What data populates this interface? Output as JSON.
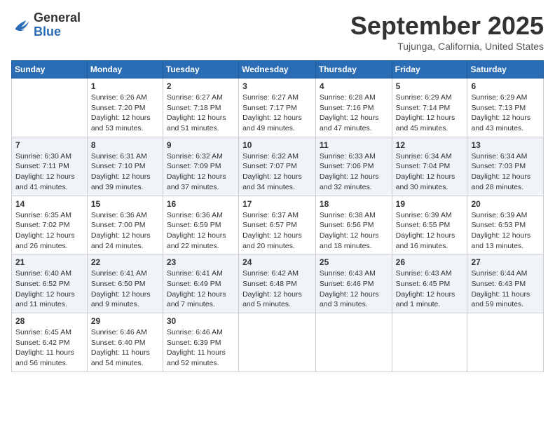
{
  "header": {
    "logo_general": "General",
    "logo_blue": "Blue",
    "month": "September 2025",
    "location": "Tujunga, California, United States"
  },
  "weekdays": [
    "Sunday",
    "Monday",
    "Tuesday",
    "Wednesday",
    "Thursday",
    "Friday",
    "Saturday"
  ],
  "weeks": [
    [
      {
        "day": "",
        "info": ""
      },
      {
        "day": "1",
        "info": "Sunrise: 6:26 AM\nSunset: 7:20 PM\nDaylight: 12 hours\nand 53 minutes."
      },
      {
        "day": "2",
        "info": "Sunrise: 6:27 AM\nSunset: 7:18 PM\nDaylight: 12 hours\nand 51 minutes."
      },
      {
        "day": "3",
        "info": "Sunrise: 6:27 AM\nSunset: 7:17 PM\nDaylight: 12 hours\nand 49 minutes."
      },
      {
        "day": "4",
        "info": "Sunrise: 6:28 AM\nSunset: 7:16 PM\nDaylight: 12 hours\nand 47 minutes."
      },
      {
        "day": "5",
        "info": "Sunrise: 6:29 AM\nSunset: 7:14 PM\nDaylight: 12 hours\nand 45 minutes."
      },
      {
        "day": "6",
        "info": "Sunrise: 6:29 AM\nSunset: 7:13 PM\nDaylight: 12 hours\nand 43 minutes."
      }
    ],
    [
      {
        "day": "7",
        "info": "Sunrise: 6:30 AM\nSunset: 7:11 PM\nDaylight: 12 hours\nand 41 minutes."
      },
      {
        "day": "8",
        "info": "Sunrise: 6:31 AM\nSunset: 7:10 PM\nDaylight: 12 hours\nand 39 minutes."
      },
      {
        "day": "9",
        "info": "Sunrise: 6:32 AM\nSunset: 7:09 PM\nDaylight: 12 hours\nand 37 minutes."
      },
      {
        "day": "10",
        "info": "Sunrise: 6:32 AM\nSunset: 7:07 PM\nDaylight: 12 hours\nand 34 minutes."
      },
      {
        "day": "11",
        "info": "Sunrise: 6:33 AM\nSunset: 7:06 PM\nDaylight: 12 hours\nand 32 minutes."
      },
      {
        "day": "12",
        "info": "Sunrise: 6:34 AM\nSunset: 7:04 PM\nDaylight: 12 hours\nand 30 minutes."
      },
      {
        "day": "13",
        "info": "Sunrise: 6:34 AM\nSunset: 7:03 PM\nDaylight: 12 hours\nand 28 minutes."
      }
    ],
    [
      {
        "day": "14",
        "info": "Sunrise: 6:35 AM\nSunset: 7:02 PM\nDaylight: 12 hours\nand 26 minutes."
      },
      {
        "day": "15",
        "info": "Sunrise: 6:36 AM\nSunset: 7:00 PM\nDaylight: 12 hours\nand 24 minutes."
      },
      {
        "day": "16",
        "info": "Sunrise: 6:36 AM\nSunset: 6:59 PM\nDaylight: 12 hours\nand 22 minutes."
      },
      {
        "day": "17",
        "info": "Sunrise: 6:37 AM\nSunset: 6:57 PM\nDaylight: 12 hours\nand 20 minutes."
      },
      {
        "day": "18",
        "info": "Sunrise: 6:38 AM\nSunset: 6:56 PM\nDaylight: 12 hours\nand 18 minutes."
      },
      {
        "day": "19",
        "info": "Sunrise: 6:39 AM\nSunset: 6:55 PM\nDaylight: 12 hours\nand 16 minutes."
      },
      {
        "day": "20",
        "info": "Sunrise: 6:39 AM\nSunset: 6:53 PM\nDaylight: 12 hours\nand 13 minutes."
      }
    ],
    [
      {
        "day": "21",
        "info": "Sunrise: 6:40 AM\nSunset: 6:52 PM\nDaylight: 12 hours\nand 11 minutes."
      },
      {
        "day": "22",
        "info": "Sunrise: 6:41 AM\nSunset: 6:50 PM\nDaylight: 12 hours\nand 9 minutes."
      },
      {
        "day": "23",
        "info": "Sunrise: 6:41 AM\nSunset: 6:49 PM\nDaylight: 12 hours\nand 7 minutes."
      },
      {
        "day": "24",
        "info": "Sunrise: 6:42 AM\nSunset: 6:48 PM\nDaylight: 12 hours\nand 5 minutes."
      },
      {
        "day": "25",
        "info": "Sunrise: 6:43 AM\nSunset: 6:46 PM\nDaylight: 12 hours\nand 3 minutes."
      },
      {
        "day": "26",
        "info": "Sunrise: 6:43 AM\nSunset: 6:45 PM\nDaylight: 12 hours\nand 1 minute."
      },
      {
        "day": "27",
        "info": "Sunrise: 6:44 AM\nSunset: 6:43 PM\nDaylight: 11 hours\nand 59 minutes."
      }
    ],
    [
      {
        "day": "28",
        "info": "Sunrise: 6:45 AM\nSunset: 6:42 PM\nDaylight: 11 hours\nand 56 minutes."
      },
      {
        "day": "29",
        "info": "Sunrise: 6:46 AM\nSunset: 6:40 PM\nDaylight: 11 hours\nand 54 minutes."
      },
      {
        "day": "30",
        "info": "Sunrise: 6:46 AM\nSunset: 6:39 PM\nDaylight: 11 hours\nand 52 minutes."
      },
      {
        "day": "",
        "info": ""
      },
      {
        "day": "",
        "info": ""
      },
      {
        "day": "",
        "info": ""
      },
      {
        "day": "",
        "info": ""
      }
    ]
  ]
}
